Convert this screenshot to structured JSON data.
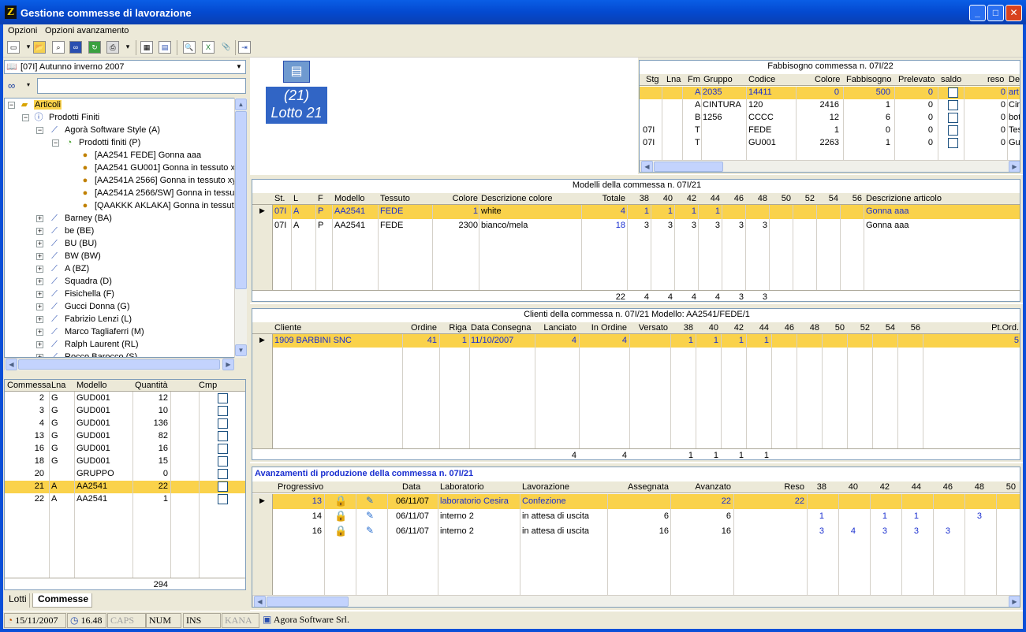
{
  "window": {
    "title": "Gestione commesse di lavorazione",
    "icon": "Z"
  },
  "menu": [
    "Opzioni",
    "Opzioni avanzamento"
  ],
  "toolbar": {
    "icons": [
      "new-doc-icon",
      "open-folder-icon",
      "preview-icon",
      "binoculars-icon",
      "refresh-icon",
      "print-icon",
      "calculator-icon",
      "grid-icon",
      "zoom-icon",
      "excel-icon",
      "paperclip-icon",
      "exit-icon"
    ]
  },
  "season": {
    "value": "[07I] Autunno inverno 2007"
  },
  "tree": {
    "root": "Articoli",
    "level1": "Prodotti Finiti",
    "brand": "Agorà Software Style (A)",
    "sub": "Prodotti finiti (P)",
    "items": [
      "[AA2541 FEDE] Gonna aaa",
      "[AA2541 GU001] Gonna in tessuto x",
      "[AA2541A 2566] Gonna in tessuto xy",
      "[AA2541A 2566/SW] Gonna in tessul",
      "[QAAKKK AKLAKA] Gonna in tessuto"
    ],
    "brands": [
      "Barney (BA)",
      "be  (BE)",
      "BU (BU)",
      "BW (BW)",
      "A (BZ)",
      "Squadra (D)",
      "Fisichella (F)",
      "Gucci Donna (G)",
      "Fabrizio Lenzi (L)",
      "Marco Tagliaferri (M)",
      "Ralph Laurent (RL)",
      "Rocco Barocco (S)"
    ]
  },
  "commesse": {
    "headers": [
      "Commessa",
      "Lna",
      "Modello",
      "Quantità",
      "Cmp"
    ],
    "rows": [
      [
        "2",
        "G",
        "GUD001",
        "12"
      ],
      [
        "3",
        "G",
        "GUD001",
        "10"
      ],
      [
        "4",
        "G",
        "GUD001",
        "136"
      ],
      [
        "13",
        "G",
        "GUD001",
        "82"
      ],
      [
        "16",
        "G",
        "GUD001",
        "16"
      ],
      [
        "18",
        "G",
        "GUD001",
        "15"
      ],
      [
        "20",
        "",
        "GRUPPO",
        "0"
      ],
      [
        "21",
        "A",
        "AA2541",
        "22"
      ],
      [
        "22",
        "A",
        "AA2541",
        "1"
      ]
    ],
    "total": "294"
  },
  "tabs": [
    "Lotti",
    "Commesse"
  ],
  "lotto": {
    "num": "(21)",
    "label": "Lotto  21"
  },
  "fabbisogno": {
    "title": "Fabbisogno commessa n. 07I/22",
    "headers": [
      "Stg",
      "Lna",
      "Fm",
      "Gruppo",
      "Codice",
      "Colore",
      "Fabbisogno",
      "Prelevato",
      "saldo",
      "reso",
      "De"
    ],
    "rows": [
      [
        "",
        "",
        "A",
        "2035",
        "14411",
        "0",
        "500",
        "0",
        "",
        "0",
        "art"
      ],
      [
        "",
        "",
        "A",
        "CINTURA",
        "120",
        "2416",
        "1",
        "0",
        "",
        "0",
        "Cin"
      ],
      [
        "",
        "",
        "B",
        "1256",
        "CCCC",
        "12",
        "6",
        "0",
        "",
        "0",
        "bot"
      ],
      [
        "07I",
        "",
        "T",
        "",
        "FEDE",
        "1",
        "0",
        "0",
        "",
        "0",
        "Tes"
      ],
      [
        "07I",
        "",
        "T",
        "",
        "GU001",
        "2263",
        "1",
        "0",
        "",
        "0",
        "Gu"
      ]
    ]
  },
  "modelli": {
    "title": "Modelli della commessa n. 07I/21",
    "headers": [
      "St.",
      "L",
      "F",
      "Modello",
      "Tessuto",
      "Colore",
      "Descrizione colore",
      "Totale",
      "38",
      "40",
      "42",
      "44",
      "46",
      "48",
      "50",
      "52",
      "54",
      "56",
      "Descrizione articolo"
    ],
    "rows": [
      [
        "07I",
        "A",
        "P",
        "AA2541",
        "FEDE",
        "1",
        "white",
        "4",
        "1",
        "1",
        "1",
        "1",
        "",
        "",
        "",
        "",
        "",
        "",
        "Gonna aaa"
      ],
      [
        "07I",
        "A",
        "P",
        "AA2541",
        "FEDE",
        "2300",
        "bianco/mela",
        "18",
        "3",
        "3",
        "3",
        "3",
        "3",
        "3",
        "",
        "",
        "",
        "",
        "Gonna aaa"
      ]
    ],
    "totals": {
      "totale": "22",
      "38": "4",
      "40": "4",
      "42": "4",
      "44": "4",
      "46": "3",
      "48": "3"
    }
  },
  "clienti": {
    "title": "Clienti della commessa n. 07I/21 Modello: AA2541/FEDE/1",
    "headers": [
      "Cliente",
      "Ordine",
      "Riga",
      "Data Consegna",
      "Lanciato",
      "In Ordine",
      "Versato",
      "38",
      "40",
      "42",
      "44",
      "46",
      "48",
      "50",
      "52",
      "54",
      "56",
      "Pt.Ord."
    ],
    "rows": [
      [
        "1909 BARBINI SNC",
        "41",
        "1",
        "11/10/2007",
        "4",
        "4",
        "",
        "1",
        "1",
        "1",
        "1",
        "",
        "",
        "",
        "",
        "",
        "",
        "5"
      ]
    ],
    "totals": {
      "lanciato": "4",
      "inordine": "4",
      "38": "1",
      "40": "1",
      "42": "1",
      "44": "1"
    }
  },
  "avanzamenti": {
    "title": "Avanzamenti di produzione della commessa n. 07I/21",
    "headers": [
      "Progressivo",
      "",
      "",
      "Data",
      "Laboratorio",
      "Lavorazione",
      "Assegnata",
      "Avanzato",
      "Reso",
      "38",
      "40",
      "42",
      "44",
      "46",
      "48",
      "50"
    ],
    "rows": [
      [
        "13",
        "06/11/07",
        "laboratorio Cesira",
        "Confezione",
        "",
        "22",
        "22",
        "",
        "",
        "",
        "",
        "",
        "",
        ""
      ],
      [
        "14",
        "06/11/07",
        "interno 2",
        "in attesa di uscita",
        "6",
        "6",
        "",
        "1",
        "",
        "1",
        "1",
        "",
        "3",
        ""
      ],
      [
        "16",
        "06/11/07",
        "interno 2",
        "in attesa di uscita",
        "16",
        "16",
        "",
        "3",
        "4",
        "3",
        "3",
        "3",
        "",
        ""
      ]
    ]
  },
  "status": {
    "date": "15/11/2007",
    "time": "16.48",
    "caps": "CAPS",
    "num": "NUM",
    "ins": "INS",
    "kana": "KANA",
    "company": "Agora Software Srl."
  }
}
